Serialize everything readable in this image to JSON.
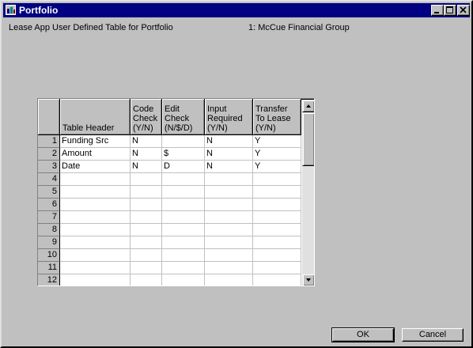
{
  "window": {
    "title": "Portfolio",
    "title_bg": "#000080",
    "face_color": "#c0c0c0",
    "controls": [
      "minimize-icon",
      "maximize-icon",
      "close-icon"
    ]
  },
  "header": {
    "left_label": "Lease App User Defined Table for Portfolio",
    "right_label": "1: McCue Financial Group"
  },
  "table": {
    "columns": [
      {
        "key": "header",
        "label": "Table Header"
      },
      {
        "key": "code",
        "label": "Code Check (Y/N)"
      },
      {
        "key": "edit",
        "label": "Edit Check (N/$/D)"
      },
      {
        "key": "input",
        "label": "Input Required (Y/N)"
      },
      {
        "key": "transfer",
        "label": "Transfer To Lease (Y/N)"
      }
    ],
    "rows": [
      {
        "num": "1",
        "header": "Funding Src",
        "code": "N",
        "edit": "",
        "input": "N",
        "transfer": "Y"
      },
      {
        "num": "2",
        "header": "Amount",
        "code": "N",
        "edit": "$",
        "input": "N",
        "transfer": "Y"
      },
      {
        "num": "3",
        "header": "Date",
        "code": "N",
        "edit": "D",
        "input": "N",
        "transfer": "Y"
      },
      {
        "num": "4",
        "header": "",
        "code": "",
        "edit": "",
        "input": "",
        "transfer": ""
      },
      {
        "num": "5",
        "header": "",
        "code": "",
        "edit": "",
        "input": "",
        "transfer": ""
      },
      {
        "num": "6",
        "header": "",
        "code": "",
        "edit": "",
        "input": "",
        "transfer": ""
      },
      {
        "num": "7",
        "header": "",
        "code": "",
        "edit": "",
        "input": "",
        "transfer": ""
      },
      {
        "num": "8",
        "header": "",
        "code": "",
        "edit": "",
        "input": "",
        "transfer": ""
      },
      {
        "num": "9",
        "header": "",
        "code": "",
        "edit": "",
        "input": "",
        "transfer": ""
      },
      {
        "num": "10",
        "header": "",
        "code": "",
        "edit": "",
        "input": "",
        "transfer": ""
      },
      {
        "num": "11",
        "header": "",
        "code": "",
        "edit": "",
        "input": "",
        "transfer": ""
      },
      {
        "num": "12",
        "header": "",
        "code": "",
        "edit": "",
        "input": "",
        "transfer": ""
      }
    ]
  },
  "buttons": {
    "ok_label": "OK",
    "cancel_label": "Cancel"
  }
}
